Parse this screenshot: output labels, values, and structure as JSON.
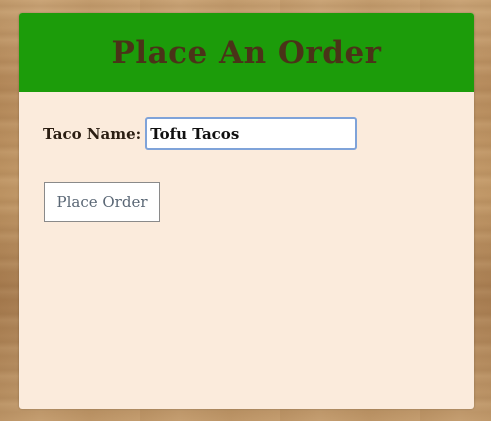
{
  "card": {
    "title": "Place An Order"
  },
  "form": {
    "taco_name_label": "Taco Name:",
    "taco_name_value": "Tofu Tacos",
    "submit_label": "Place Order"
  },
  "colors": {
    "header_background": "#1c9c0a",
    "title_text": "#4a3318",
    "card_background": "#fbebdc",
    "input_focus_border": "#7fa3d9"
  },
  "background": {
    "texture": "wood"
  }
}
